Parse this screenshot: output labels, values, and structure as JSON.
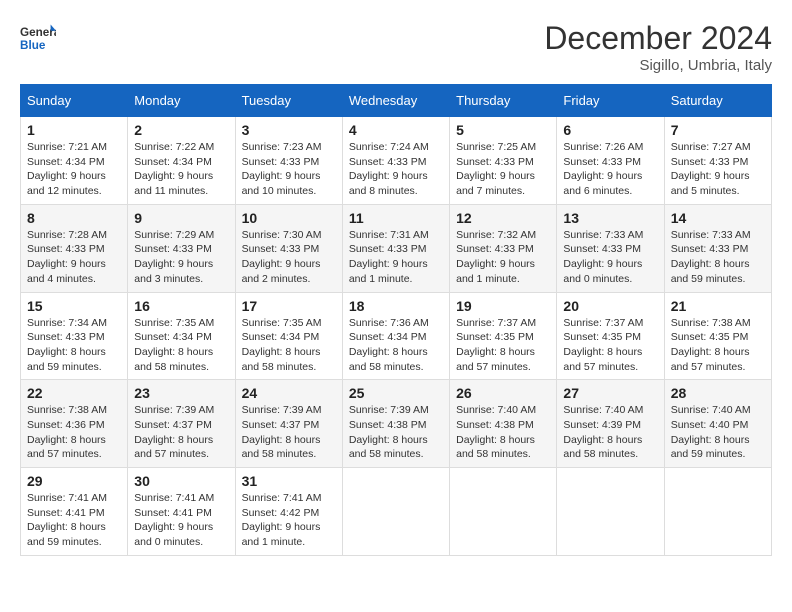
{
  "header": {
    "logo_line1": "General",
    "logo_line2": "Blue",
    "month": "December 2024",
    "location": "Sigillo, Umbria, Italy"
  },
  "weekdays": [
    "Sunday",
    "Monday",
    "Tuesday",
    "Wednesday",
    "Thursday",
    "Friday",
    "Saturday"
  ],
  "weeks": [
    [
      {
        "day": "1",
        "info": "Sunrise: 7:21 AM\nSunset: 4:34 PM\nDaylight: 9 hours and 12 minutes."
      },
      {
        "day": "2",
        "info": "Sunrise: 7:22 AM\nSunset: 4:34 PM\nDaylight: 9 hours and 11 minutes."
      },
      {
        "day": "3",
        "info": "Sunrise: 7:23 AM\nSunset: 4:33 PM\nDaylight: 9 hours and 10 minutes."
      },
      {
        "day": "4",
        "info": "Sunrise: 7:24 AM\nSunset: 4:33 PM\nDaylight: 9 hours and 8 minutes."
      },
      {
        "day": "5",
        "info": "Sunrise: 7:25 AM\nSunset: 4:33 PM\nDaylight: 9 hours and 7 minutes."
      },
      {
        "day": "6",
        "info": "Sunrise: 7:26 AM\nSunset: 4:33 PM\nDaylight: 9 hours and 6 minutes."
      },
      {
        "day": "7",
        "info": "Sunrise: 7:27 AM\nSunset: 4:33 PM\nDaylight: 9 hours and 5 minutes."
      }
    ],
    [
      {
        "day": "8",
        "info": "Sunrise: 7:28 AM\nSunset: 4:33 PM\nDaylight: 9 hours and 4 minutes."
      },
      {
        "day": "9",
        "info": "Sunrise: 7:29 AM\nSunset: 4:33 PM\nDaylight: 9 hours and 3 minutes."
      },
      {
        "day": "10",
        "info": "Sunrise: 7:30 AM\nSunset: 4:33 PM\nDaylight: 9 hours and 2 minutes."
      },
      {
        "day": "11",
        "info": "Sunrise: 7:31 AM\nSunset: 4:33 PM\nDaylight: 9 hours and 1 minute."
      },
      {
        "day": "12",
        "info": "Sunrise: 7:32 AM\nSunset: 4:33 PM\nDaylight: 9 hours and 1 minute."
      },
      {
        "day": "13",
        "info": "Sunrise: 7:33 AM\nSunset: 4:33 PM\nDaylight: 9 hours and 0 minutes."
      },
      {
        "day": "14",
        "info": "Sunrise: 7:33 AM\nSunset: 4:33 PM\nDaylight: 8 hours and 59 minutes."
      }
    ],
    [
      {
        "day": "15",
        "info": "Sunrise: 7:34 AM\nSunset: 4:33 PM\nDaylight: 8 hours and 59 minutes."
      },
      {
        "day": "16",
        "info": "Sunrise: 7:35 AM\nSunset: 4:34 PM\nDaylight: 8 hours and 58 minutes."
      },
      {
        "day": "17",
        "info": "Sunrise: 7:35 AM\nSunset: 4:34 PM\nDaylight: 8 hours and 58 minutes."
      },
      {
        "day": "18",
        "info": "Sunrise: 7:36 AM\nSunset: 4:34 PM\nDaylight: 8 hours and 58 minutes."
      },
      {
        "day": "19",
        "info": "Sunrise: 7:37 AM\nSunset: 4:35 PM\nDaylight: 8 hours and 57 minutes."
      },
      {
        "day": "20",
        "info": "Sunrise: 7:37 AM\nSunset: 4:35 PM\nDaylight: 8 hours and 57 minutes."
      },
      {
        "day": "21",
        "info": "Sunrise: 7:38 AM\nSunset: 4:35 PM\nDaylight: 8 hours and 57 minutes."
      }
    ],
    [
      {
        "day": "22",
        "info": "Sunrise: 7:38 AM\nSunset: 4:36 PM\nDaylight: 8 hours and 57 minutes."
      },
      {
        "day": "23",
        "info": "Sunrise: 7:39 AM\nSunset: 4:37 PM\nDaylight: 8 hours and 57 minutes."
      },
      {
        "day": "24",
        "info": "Sunrise: 7:39 AM\nSunset: 4:37 PM\nDaylight: 8 hours and 58 minutes."
      },
      {
        "day": "25",
        "info": "Sunrise: 7:39 AM\nSunset: 4:38 PM\nDaylight: 8 hours and 58 minutes."
      },
      {
        "day": "26",
        "info": "Sunrise: 7:40 AM\nSunset: 4:38 PM\nDaylight: 8 hours and 58 minutes."
      },
      {
        "day": "27",
        "info": "Sunrise: 7:40 AM\nSunset: 4:39 PM\nDaylight: 8 hours and 58 minutes."
      },
      {
        "day": "28",
        "info": "Sunrise: 7:40 AM\nSunset: 4:40 PM\nDaylight: 8 hours and 59 minutes."
      }
    ],
    [
      {
        "day": "29",
        "info": "Sunrise: 7:41 AM\nSunset: 4:41 PM\nDaylight: 8 hours and 59 minutes."
      },
      {
        "day": "30",
        "info": "Sunrise: 7:41 AM\nSunset: 4:41 PM\nDaylight: 9 hours and 0 minutes."
      },
      {
        "day": "31",
        "info": "Sunrise: 7:41 AM\nSunset: 4:42 PM\nDaylight: 9 hours and 1 minute."
      },
      null,
      null,
      null,
      null
    ]
  ]
}
